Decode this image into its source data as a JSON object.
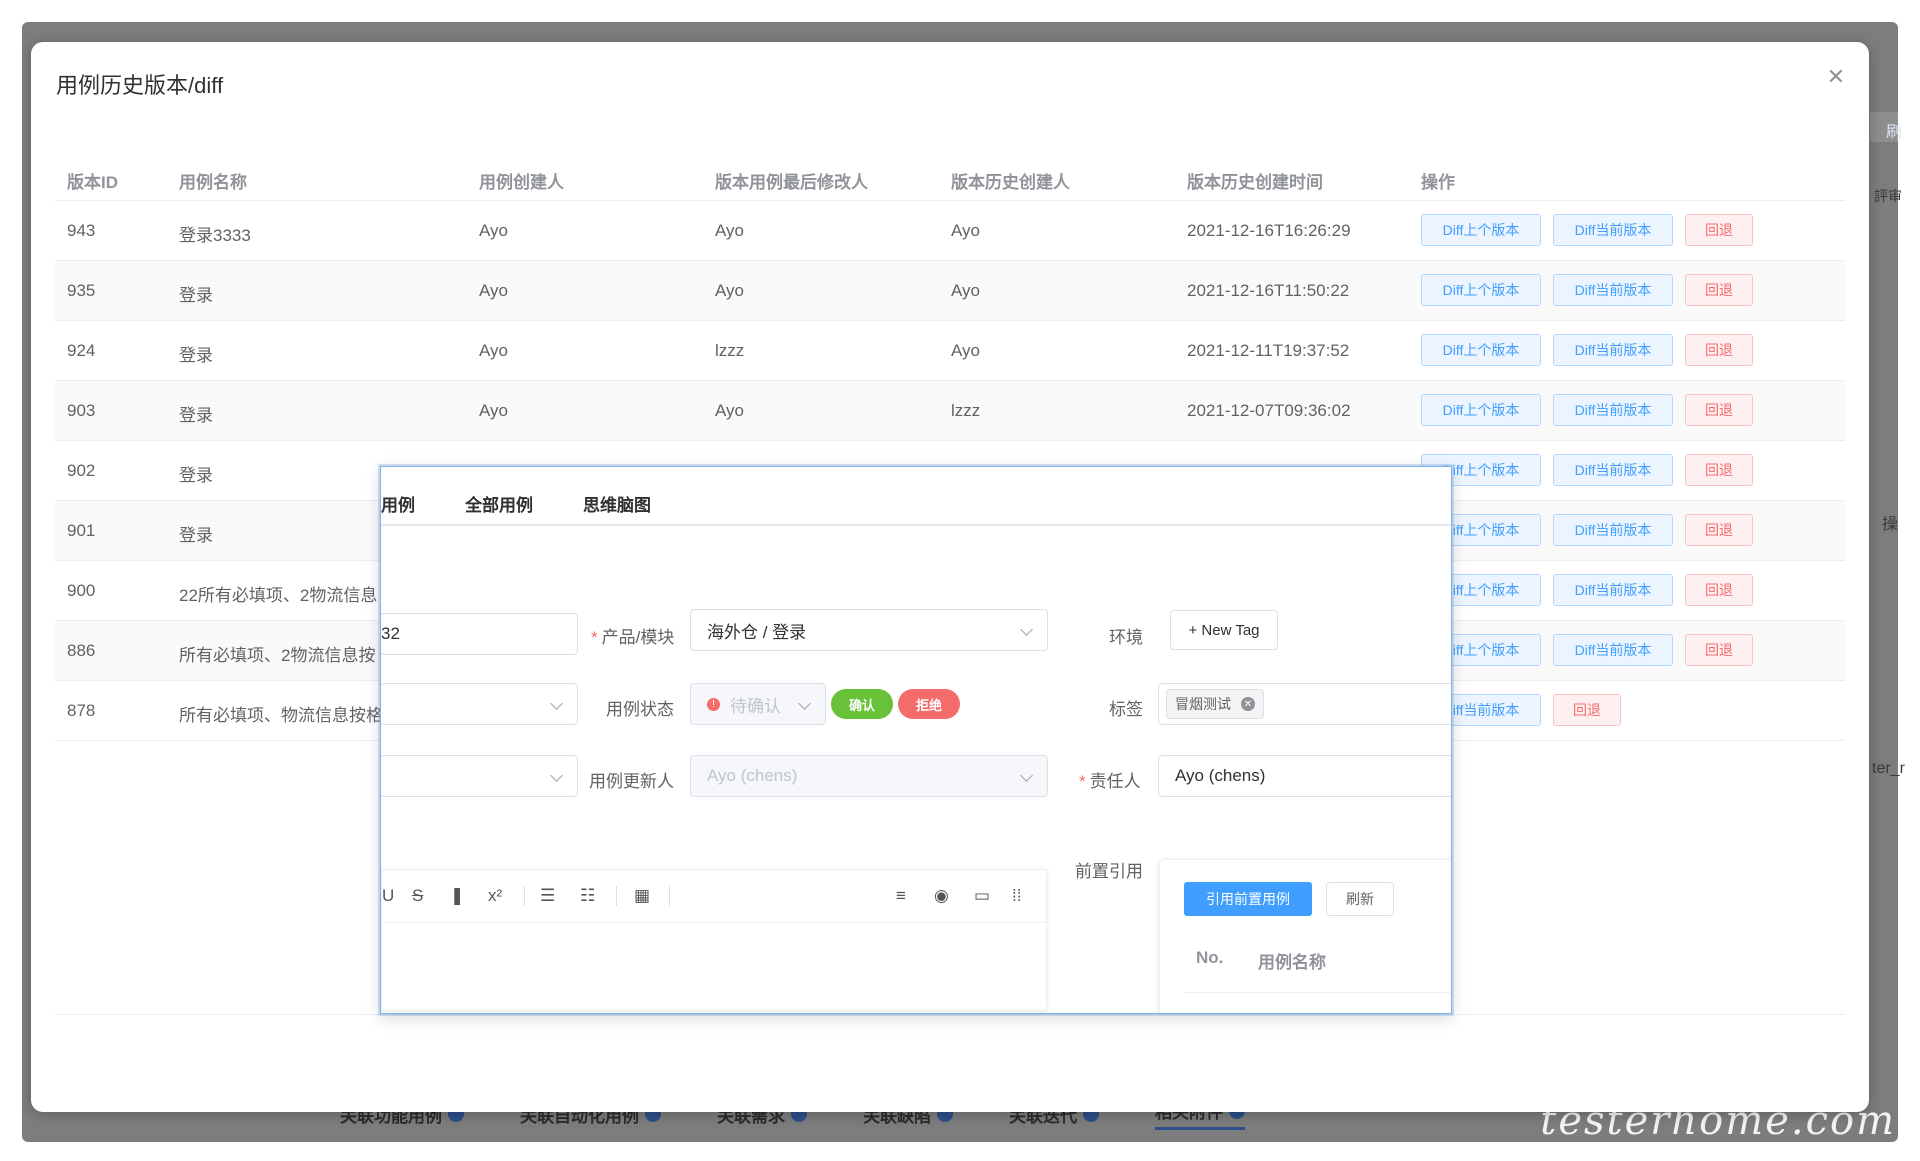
{
  "dialog": {
    "title": "用例历史版本/diff"
  },
  "table": {
    "headers": [
      "版本ID",
      "用例名称",
      "用例创建人",
      "版本用例最后修改人",
      "版本历史创建人",
      "版本历史创建时间",
      "操作"
    ],
    "rows": [
      {
        "id": "943",
        "name": "登录3333",
        "creator": "Ayo",
        "modifier": "Ayo",
        "history_creator": "Ayo",
        "time": "2021-12-16T16:26:29"
      },
      {
        "id": "935",
        "name": "登录",
        "creator": "Ayo",
        "modifier": "Ayo",
        "history_creator": "Ayo",
        "time": "2021-12-16T11:50:22"
      },
      {
        "id": "924",
        "name": "登录",
        "creator": "Ayo",
        "modifier": "lzzz",
        "history_creator": "Ayo",
        "time": "2021-12-11T19:37:52"
      },
      {
        "id": "903",
        "name": "登录",
        "creator": "Ayo",
        "modifier": "Ayo",
        "history_creator": "lzzz",
        "time": "2021-12-07T09:36:02"
      },
      {
        "id": "902",
        "name": "登录",
        "creator": "",
        "modifier": "",
        "history_creator": "",
        "time": ""
      },
      {
        "id": "901",
        "name": "登录",
        "creator": "",
        "modifier": "",
        "history_creator": "",
        "time": ""
      },
      {
        "id": "900",
        "name": "22所有必填项、2物流信息",
        "creator": "",
        "modifier": "",
        "history_creator": "",
        "time": ""
      },
      {
        "id": "886",
        "name": "所有必填项、2物流信息按",
        "creator": "",
        "modifier": "",
        "history_creator": "",
        "time": ""
      },
      {
        "id": "878",
        "name": "所有必填项、物流信息按格",
        "creator": "",
        "modifier": "",
        "history_creator": "",
        "time": ""
      }
    ],
    "actions": {
      "diff_prev": "Diff上个版本",
      "diff_prev_partial": "iff上个版本",
      "diff_curr": "Diff当前版本",
      "diff_curr_partial": "iff当前版本",
      "rollback": "回退"
    }
  },
  "overlay": {
    "tabs": [
      "用例",
      "全部用例",
      "思维脑图"
    ],
    "id_value": "32",
    "product_label": "产品/模块",
    "product_value": "海外仓 / 登录",
    "env_label": "环境",
    "new_tag": "+ New Tag",
    "status_label": "用例状态",
    "status_value": "待确认",
    "confirm": "确认",
    "reject": "拒绝",
    "tags_label": "标签",
    "tag_chip": "冒烟测试",
    "updater_label": "用例更新人",
    "updater_value": "Ayo (chens)",
    "owner_label": "责任人",
    "owner_value": "Ayo (chens)",
    "preref_label": "前置引用",
    "cite_button": "引用前置用例",
    "refresh_button": "刷新",
    "ref_cols": [
      "No.",
      "用例名称"
    ]
  },
  "background": {
    "tabs": [
      "关联功能用例",
      "关联自动化用例",
      "关联需求",
      "关联缺陷",
      "关联迭代",
      "相关附件"
    ],
    "side_texts": [
      "刷",
      "操",
      "ter_r",
      "評审"
    ]
  },
  "watermark": "testerhome.com",
  "colors": {
    "primary": "#409eff",
    "danger": "#f56c6c",
    "success": "#67c23a",
    "border": "#dcdfe6"
  }
}
